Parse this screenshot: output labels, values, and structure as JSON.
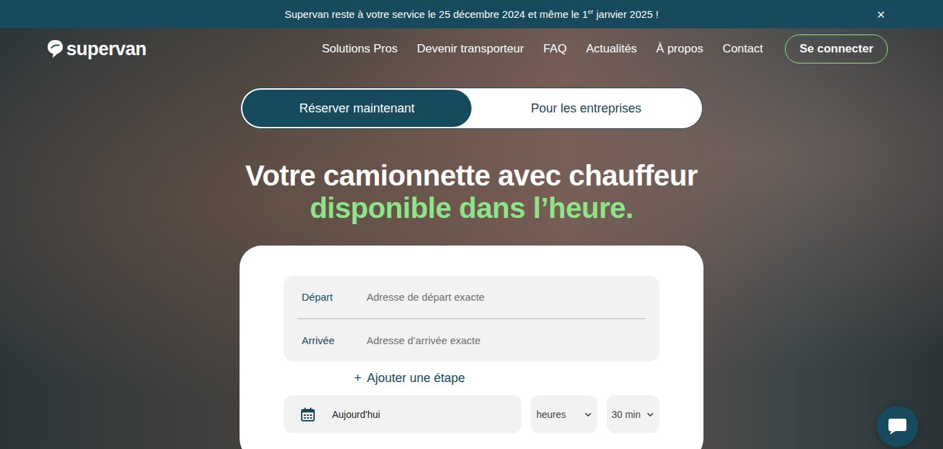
{
  "banner": {
    "text_before": "Supervan reste à votre service le 25 décembre 2024 et même le 1",
    "superscript": "er",
    "text_after": " janvier 2025 !",
    "close": "×"
  },
  "logo": {
    "text": "supervan"
  },
  "nav": {
    "links": [
      "Solutions Pros",
      "Devenir transporteur",
      "FAQ",
      "Actualités",
      "À propos",
      "Contact"
    ],
    "login": "Se connecter"
  },
  "tabs": [
    {
      "label": "Réserver maintenant",
      "selected": true
    },
    {
      "label": "Pour les entreprises",
      "selected": false
    }
  ],
  "heading": {
    "line1": "Votre camionnette avec chauffeur",
    "line2": "disponible dans l’heure."
  },
  "form": {
    "addresses": [
      {
        "label": "Départ",
        "placeholder": "Adresse de départ exacte"
      },
      {
        "label": "Arrivée",
        "placeholder": "Adresse d’arrivée exacte"
      }
    ],
    "add_stop": {
      "icon": "+",
      "label": "Ajouter une étape"
    },
    "date": "Aujourd'hui",
    "hours": "heures",
    "minutes": "30 min"
  }
}
